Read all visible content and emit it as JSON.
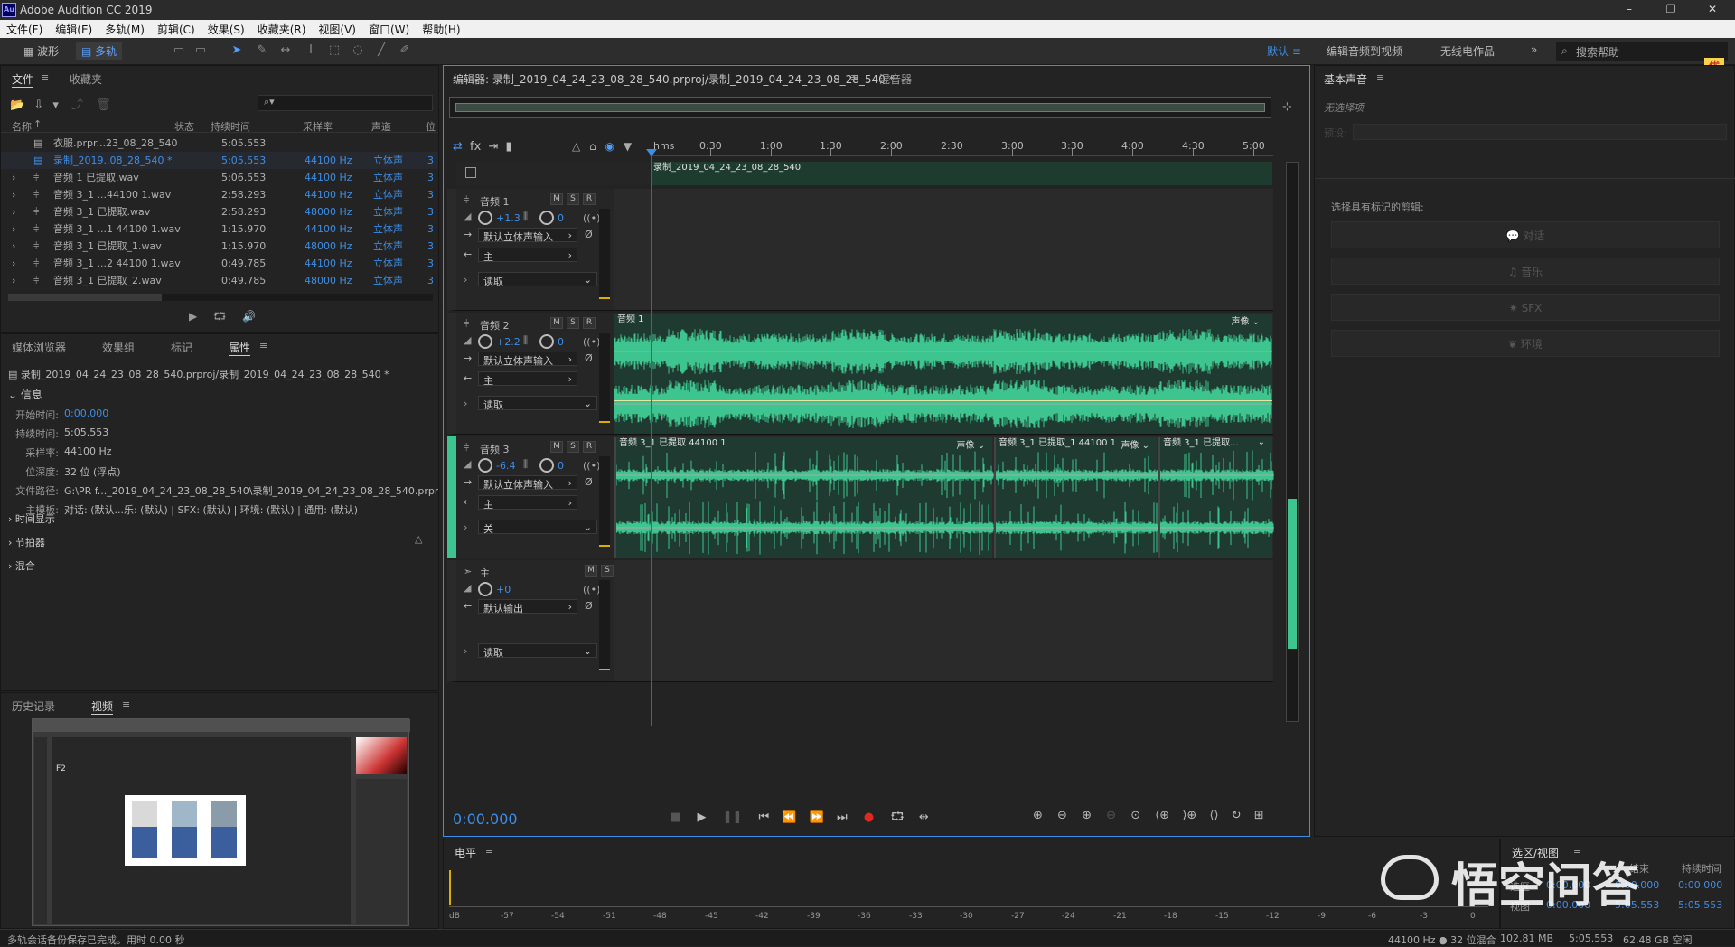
{
  "app": {
    "title": "Adobe Audition CC 2019",
    "logo": "Au"
  },
  "menu": [
    "文件(F)",
    "编辑(E)",
    "多轨(M)",
    "剪辑(C)",
    "效果(S)",
    "收藏夹(R)",
    "视图(V)",
    "窗口(W)",
    "帮助(H)"
  ],
  "toolbar": {
    "waveform": "波形",
    "multitrack": "多轨"
  },
  "workspaces": {
    "default": "默认",
    "edit_video": "编辑音频到视频",
    "radio": "无线电作品",
    "search_placeholder": "搜索帮助"
  },
  "files_panel": {
    "tabs": [
      "文件",
      "收藏夹"
    ],
    "headers": [
      "名称",
      "状态",
      "持续时间",
      "采样率",
      "声道",
      "位"
    ],
    "rows": [
      {
        "name": "衣服.prpr...23_08_28_540",
        "duration": "5:05.553",
        "rate": "",
        "channel": "",
        "bits": ""
      },
      {
        "name": "录制_2019..08_28_540 *",
        "duration": "5:05.553",
        "rate": "44100 Hz",
        "channel": "立体声",
        "bits": "3"
      },
      {
        "name": "音频 1 已提取.wav",
        "duration": "5:06.553",
        "rate": "44100 Hz",
        "channel": "立体声",
        "bits": "3"
      },
      {
        "name": "音频 3_1 ...44100 1.wav",
        "duration": "2:58.293",
        "rate": "44100 Hz",
        "channel": "立体声",
        "bits": "3"
      },
      {
        "name": "音频 3_1 已提取.wav",
        "duration": "2:58.293",
        "rate": "48000 Hz",
        "channel": "立体声",
        "bits": "3"
      },
      {
        "name": "音频 3_1 ...1 44100 1.wav",
        "duration": "1:15.970",
        "rate": "44100 Hz",
        "channel": "立体声",
        "bits": "3"
      },
      {
        "name": "音频 3_1 已提取_1.wav",
        "duration": "1:15.970",
        "rate": "48000 Hz",
        "channel": "立体声",
        "bits": "3"
      },
      {
        "name": "音频 3_1 ...2 44100 1.wav",
        "duration": "0:49.785",
        "rate": "44100 Hz",
        "channel": "立体声",
        "bits": "3"
      },
      {
        "name": "音频 3_1 已提取_2.wav",
        "duration": "0:49.785",
        "rate": "48000 Hz",
        "channel": "立体声",
        "bits": "3"
      }
    ]
  },
  "props_panel": {
    "tabs": [
      "媒体浏览器",
      "效果组",
      "标记",
      "属性"
    ],
    "path": "录制_2019_04_24_23_08_28_540.prproj/录制_2019_04_24_23_08_28_540 *",
    "info_title": "信息",
    "info": [
      {
        "k": "开始时间:",
        "v": "0:00.000"
      },
      {
        "k": "持续时间:",
        "v": "5:05.553"
      },
      {
        "k": "采样率:",
        "v": "44100 Hz"
      },
      {
        "k": "位深度:",
        "v": "32 位 (浮点)"
      },
      {
        "k": "文件路径:",
        "v": "G:\\PR f..._2019_04_24_23_08_28_540\\录制_2019_04_24_23_08_28_540.prproj"
      },
      {
        "k": "主模板:",
        "v": "对话: (默认...乐: (默认) | SFX: (默认) | 环境: (默认) | 通用: (默认)"
      }
    ],
    "sections": [
      "时间显示",
      "节拍器",
      "混合"
    ]
  },
  "history_panel": {
    "tabs": [
      "历史记录",
      "视频"
    ],
    "thumb_label": "F2"
  },
  "editor": {
    "tab": "编辑器: 录制_2019_04_24_23_08_28_540.prproj/录制_2019_04_24_23_08_28_540 *",
    "mixer_tab": "混音器",
    "ruler_unit": "hms",
    "ruler": [
      "0:30",
      "1:00",
      "1:30",
      "2:00",
      "2:30",
      "3:00",
      "3:30",
      "4:00",
      "4:30",
      "5:00"
    ],
    "video_track_label": "录制_2019_04_24_23_08_28_540",
    "timecode": "0:00.000"
  },
  "tracks": [
    {
      "name": "音频 1",
      "volume": "+1.3",
      "pan": "0",
      "input": "默认立体声输入",
      "output": "主",
      "mode": "读取"
    },
    {
      "name": "音频 2",
      "volume": "+2.2",
      "pan": "0",
      "input": "默认立体声输入",
      "output": "主",
      "mode": "读取",
      "clip": "音频 1",
      "clip_tag": "声像"
    },
    {
      "name": "音频 3",
      "volume": "-6.4",
      "pan": "0",
      "input": "默认立体声输入",
      "output": "主",
      "mode": "关",
      "clips": [
        {
          "label": "音频 3_1 已提取 44100 1",
          "tag": "声像"
        },
        {
          "label": "音频 3_1 已提取_1 44100 1",
          "tag": "声像"
        },
        {
          "label": "音频 3_1 已提取...",
          "tag": ""
        }
      ]
    },
    {
      "name": "主",
      "volume": "+0",
      "output": "默认输出",
      "mode": "读取"
    }
  ],
  "track_buttons": {
    "m": "M",
    "s": "S",
    "r": "R"
  },
  "levels": {
    "title": "电平",
    "scale": [
      "dB",
      "-57",
      "-54",
      "-51",
      "-48",
      "-45",
      "-42",
      "-39",
      "-36",
      "-33",
      "-30",
      "-27",
      "-24",
      "-21",
      "-18",
      "-15",
      "-12",
      "-9",
      "-6",
      "-3",
      "0"
    ]
  },
  "selection": {
    "title": "选区/视图",
    "end_header": "结束",
    "dur_header": "持续时间",
    "row1": [
      "0:00.000",
      "0:00.000",
      "0:00.000"
    ],
    "row2": [
      "0:00.000",
      "5:05.553",
      "5:05.553"
    ],
    "labels": [
      "选区",
      "视图"
    ]
  },
  "essential_sound": {
    "title": "基本声音",
    "no_selection": "无选择项",
    "preset_label": "预设:",
    "prompt": "选择具有标记的剪辑:",
    "buttons": [
      "对话",
      "音乐",
      "SFX",
      "环境"
    ]
  },
  "status": {
    "left": "多轨会话备份保存已完成。用时 0.00 秒",
    "right": [
      "44100 Hz ● 32 位混合",
      "102.81 MB",
      "5:05.553",
      "62.48 GB 空闲"
    ]
  },
  "watermark": {
    "text": "悟空问答",
    "badge": "优惠"
  },
  "colors": {
    "accent": "#3d8ee6",
    "wave": "#3ec48e",
    "playhead": "#e0281f"
  }
}
